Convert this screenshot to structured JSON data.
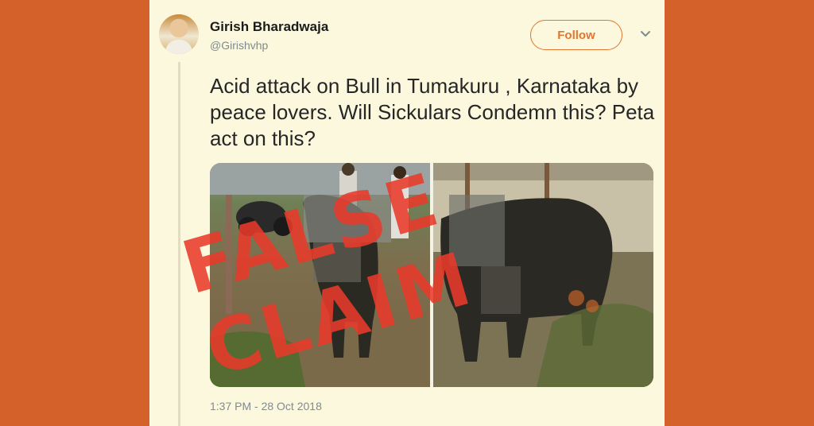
{
  "author": {
    "name": "Girish Bharadwaja",
    "handle": "@Girishvhp"
  },
  "actions": {
    "follow_label": "Follow"
  },
  "tweet": {
    "text": "Acid attack on Bull in Tumakuru , Karnataka by peace lovers. Will Sickulars Condemn this? Peta act on this?",
    "timestamp": "1:37 PM - 28 Oct 2018"
  },
  "overlay": {
    "stamp_text": "FALSE CLAIM",
    "stamp_color": "#e83a2a"
  },
  "colors": {
    "background": "#d4602a",
    "card": "#fbf8dd",
    "accent": "#e0762f"
  },
  "icons": {
    "menu": "chevron-down-icon"
  }
}
